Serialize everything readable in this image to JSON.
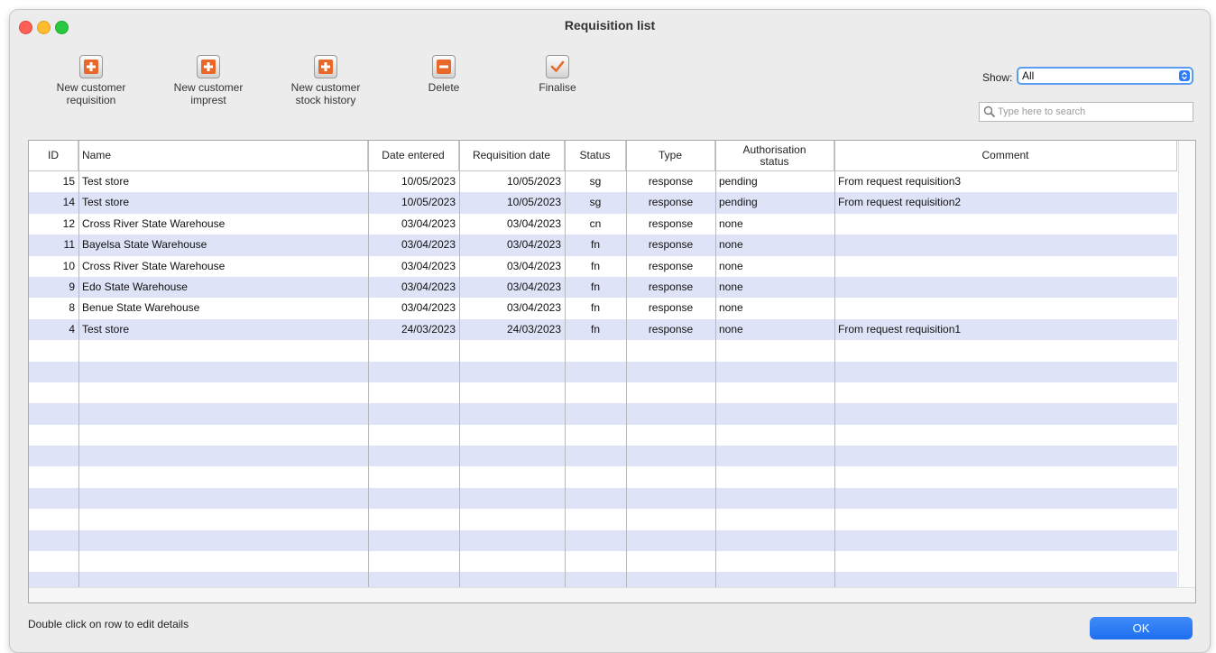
{
  "window": {
    "title": "Requisition list"
  },
  "toolbar": {
    "new_customer_requisition": "New customer\nrequisition",
    "new_customer_imprest": "New customer\nimprest",
    "new_customer_stock_history": "New customer\nstock history",
    "delete": "Delete",
    "finalise": "Finalise",
    "icons": [
      "add-icon",
      "add-icon",
      "add-icon",
      "minus-icon",
      "checkmark-icon"
    ]
  },
  "filter": {
    "show_label": "Show:",
    "show_value": "All",
    "search_placeholder": "Type here to search"
  },
  "table": {
    "columns": [
      "ID",
      "Name",
      "Date entered",
      "Requisition date",
      "Status",
      "Type",
      "Authorisation status",
      "Comment"
    ],
    "rows": [
      {
        "id": "15",
        "name": "Test store",
        "date_entered": "10/05/2023",
        "requisition_date": "10/05/2023",
        "status": "sg",
        "type": "response",
        "authorisation": "pending",
        "comment": "From request requisition3"
      },
      {
        "id": "14",
        "name": "Test store",
        "date_entered": "10/05/2023",
        "requisition_date": "10/05/2023",
        "status": "sg",
        "type": "response",
        "authorisation": "pending",
        "comment": "From request requisition2"
      },
      {
        "id": "12",
        "name": "Cross River State Warehouse",
        "date_entered": "03/04/2023",
        "requisition_date": "03/04/2023",
        "status": "cn",
        "type": "response",
        "authorisation": "none",
        "comment": ""
      },
      {
        "id": "11",
        "name": "Bayelsa State Warehouse",
        "date_entered": "03/04/2023",
        "requisition_date": "03/04/2023",
        "status": "fn",
        "type": "response",
        "authorisation": "none",
        "comment": ""
      },
      {
        "id": "10",
        "name": "Cross River State Warehouse",
        "date_entered": "03/04/2023",
        "requisition_date": "03/04/2023",
        "status": "fn",
        "type": "response",
        "authorisation": "none",
        "comment": ""
      },
      {
        "id": "9",
        "name": "Edo State Warehouse",
        "date_entered": "03/04/2023",
        "requisition_date": "03/04/2023",
        "status": "fn",
        "type": "response",
        "authorisation": "none",
        "comment": ""
      },
      {
        "id": "8",
        "name": "Benue State Warehouse",
        "date_entered": "03/04/2023",
        "requisition_date": "03/04/2023",
        "status": "fn",
        "type": "response",
        "authorisation": "none",
        "comment": ""
      },
      {
        "id": "4",
        "name": "Test store",
        "date_entered": "24/03/2023",
        "requisition_date": "24/03/2023",
        "status": "fn",
        "type": "response",
        "authorisation": "none",
        "comment": "From request requisition1"
      }
    ]
  },
  "footer": {
    "hint": "Double click on row to edit details",
    "ok_label": "OK"
  },
  "colors": {
    "alt_row": "#dfe3f7",
    "accent": "#2f7cf6",
    "add_icon": "#e8682a"
  }
}
